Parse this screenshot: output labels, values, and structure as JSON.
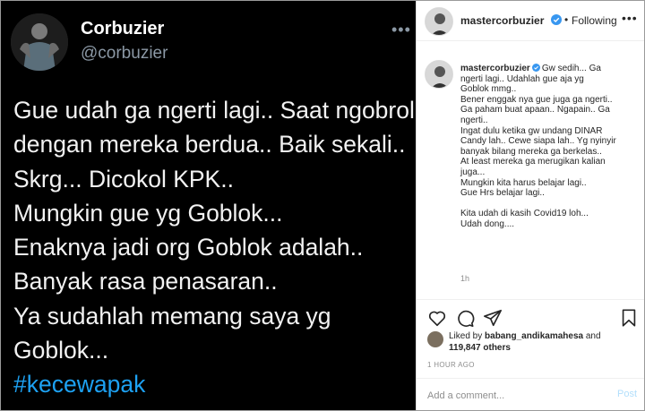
{
  "tweet": {
    "display_name": "Corbuzier",
    "handle": "@corbuzier",
    "more": "•••",
    "lines": [
      "Gue udah ga ngerti lagi.. Saat ngobrol",
      "dengan mereka berdua.. Baik sekali..",
      "Skrg... Dicokol KPK..",
      "Mungkin gue yg Goblok...",
      "Enaknya jadi org Goblok adalah..",
      "Banyak rasa penasaran..",
      "Ya sudahlah memang saya yg",
      "Goblok..."
    ],
    "hashtag": "#kecewapak",
    "hashtag_color": "#1da1f2"
  },
  "instagram": {
    "header": {
      "username": "mastercorbuzier",
      "dot": "•",
      "follow_label": "Following",
      "menu": "•••"
    },
    "caption": {
      "username": "mastercorbuzier",
      "first_line_text": "Gw sedih... Ga",
      "lines": [
        "ngerti lagi.. Udahlah gue aja yg",
        "Goblok mmg..",
        "Bener enggak nya gue juga ga ngerti..",
        "Ga paham buat apaan.. Ngapain.. Ga",
        "ngerti..",
        "Ingat dulu ketika gw undang DINAR",
        "Candy lah.. Cewe siapa lah.. Yg nyinyir",
        "banyak bilang mereka ga berkelas..",
        "At least mereka ga merugikan kalian",
        "juga...",
        "Mungkin kita harus belajar lagi..",
        "Gue Hrs belajar lagi.."
      ],
      "lines_after_gap": [
        "Kita udah di kasih Covid19 loh...",
        "Udah dong...."
      ],
      "time_ago": "1h"
    },
    "likes": {
      "prefix": "Liked by ",
      "user": "babang_andikamahesa",
      "and": " and",
      "count": "119,847 others"
    },
    "timestamp": "1 HOUR AGO",
    "comment": {
      "placeholder": "Add a comment...",
      "post_label": "Post"
    },
    "colors": {
      "verified": "#3897f0",
      "post_disabled": "#b2dffc"
    }
  }
}
